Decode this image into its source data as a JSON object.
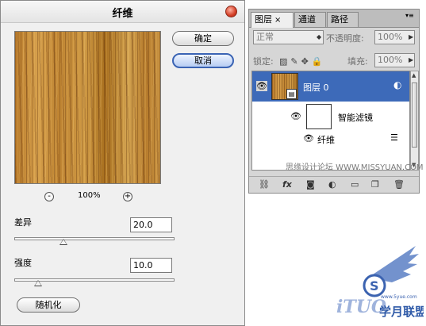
{
  "dialog": {
    "title": "纤维",
    "ok_label": "确定",
    "cancel_label": "取消",
    "zoom_out": "-",
    "zoom_in": "+",
    "zoom_level": "100%",
    "variance_label": "差异",
    "variance_value": "20.0",
    "strength_label": "强度",
    "strength_value": "10.0",
    "randomize_label": "随机化"
  },
  "layers_panel": {
    "tabs": [
      {
        "label": "图层",
        "close": "×"
      },
      {
        "label": "通道"
      },
      {
        "label": "路径"
      }
    ],
    "menu_icon": "▾≡",
    "blend_mode": "正常",
    "opacity_label": "不透明度:",
    "opacity_value": "100%",
    "lock_label": "锁定:",
    "fill_label": "填充:",
    "fill_value": "100%",
    "layer_name": "图层 0",
    "smart_filters_label": "智能滤镜",
    "filter_name": "纤维",
    "watermark": "思缘设计论坛 WWW.MISSYUAN.COM",
    "toolbar_icons": [
      "link-icon",
      "fx-icon",
      "mask-icon",
      "adjustment-icon",
      "folder-icon",
      "new-layer-icon",
      "trash-icon"
    ]
  },
  "logo": {
    "text": "iTUO",
    "brand": "学月联盟",
    "url_text": "www.5yue.com",
    "badge": "S"
  }
}
